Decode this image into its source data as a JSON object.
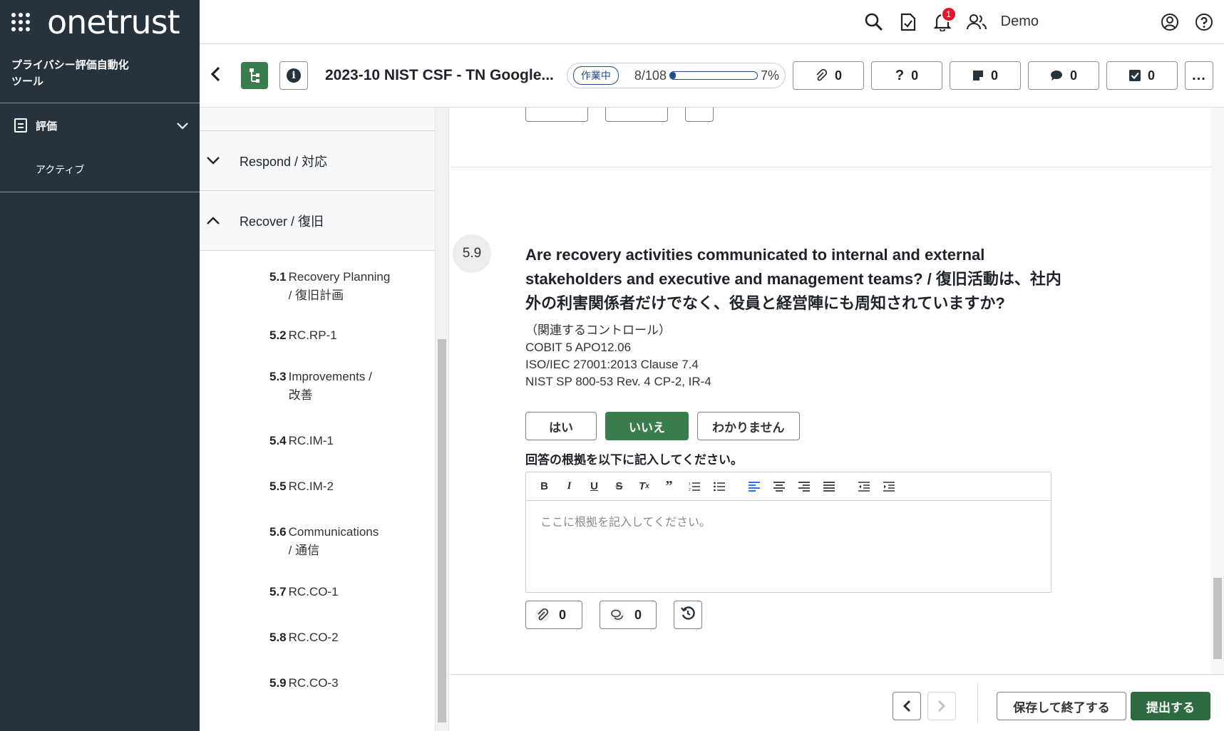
{
  "brand": {
    "logo": "onetrust",
    "app_subtitle": "プライバシー評価自動化ツール"
  },
  "sidebar": {
    "items": [
      {
        "label": "評価",
        "icon": "document-icon",
        "expanded": true,
        "children": [
          {
            "label": "アクティブ"
          }
        ]
      }
    ]
  },
  "topbar": {
    "notification_count": "1",
    "user_name": "Demo"
  },
  "assessment": {
    "title": "2023-10 NIST CSF - TN Google...",
    "status": "作業中",
    "progress_count": "8/108",
    "progress_percent": "7%",
    "progress_value": 0.07,
    "counters": {
      "attachments": "0",
      "questions": "0",
      "notes": "0",
      "comments": "0",
      "tasks": "0"
    },
    "more": "..."
  },
  "tree": {
    "sections": [
      {
        "label": "Respond / 対応",
        "expanded": false
      },
      {
        "label": "Recover / 復旧",
        "expanded": true
      }
    ],
    "questions": [
      {
        "num": "5.1",
        "label": "Recovery Planning\n/ 復旧計画"
      },
      {
        "num": "5.2",
        "label": "RC.RP-1"
      },
      {
        "num": "5.3",
        "label": "Improvements /\n改善"
      },
      {
        "num": "5.4",
        "label": "RC.IM-1"
      },
      {
        "num": "5.5",
        "label": "RC.IM-2"
      },
      {
        "num": "5.6",
        "label": "Communications\n/ 通信"
      },
      {
        "num": "5.7",
        "label": "RC.CO-1"
      },
      {
        "num": "5.8",
        "label": "RC.CO-2"
      },
      {
        "num": "5.9",
        "label": "RC.CO-3"
      }
    ]
  },
  "question": {
    "number": "5.9",
    "text": "Are recovery activities communicated to internal and external stakeholders and executive and management teams? / 復旧活動は、社内外の利害関係者だけでなく、役員と経営陣にも周知されていますか?",
    "controls": "（関連するコントロール）\nCOBIT 5 APO12.06\nISO/IEC 27001:2013 Clause 7.4\nNIST SP 800-53 Rev. 4 CP-2, IR-4",
    "options": [
      {
        "label": "はい",
        "selected": false
      },
      {
        "label": "いいえ",
        "selected": true
      },
      {
        "label": "わかりません",
        "selected": false
      }
    ],
    "justification_label": "回答の根拠を以下に記入してください。",
    "justification_placeholder": "ここに根拠を記入してください。",
    "attachment_count": "0",
    "comment_count": "0"
  },
  "toolbar_buttons": [
    "bold-icon",
    "italic-icon",
    "underline-icon",
    "strikethrough-icon",
    "clear-format-icon",
    "quote-icon",
    "ordered-list-icon",
    "bullet-list-icon",
    "align-left-icon",
    "align-center-icon",
    "align-right-icon",
    "align-justify-icon",
    "outdent-icon",
    "indent-icon"
  ],
  "footer": {
    "save_label": "保存して終了する",
    "submit_label": "提出する"
  },
  "colors": {
    "sidebar": "#26323c",
    "accent_green": "#3a7d4c",
    "progress_blue": "#1e4e8c",
    "badge_red": "#e0162b"
  }
}
